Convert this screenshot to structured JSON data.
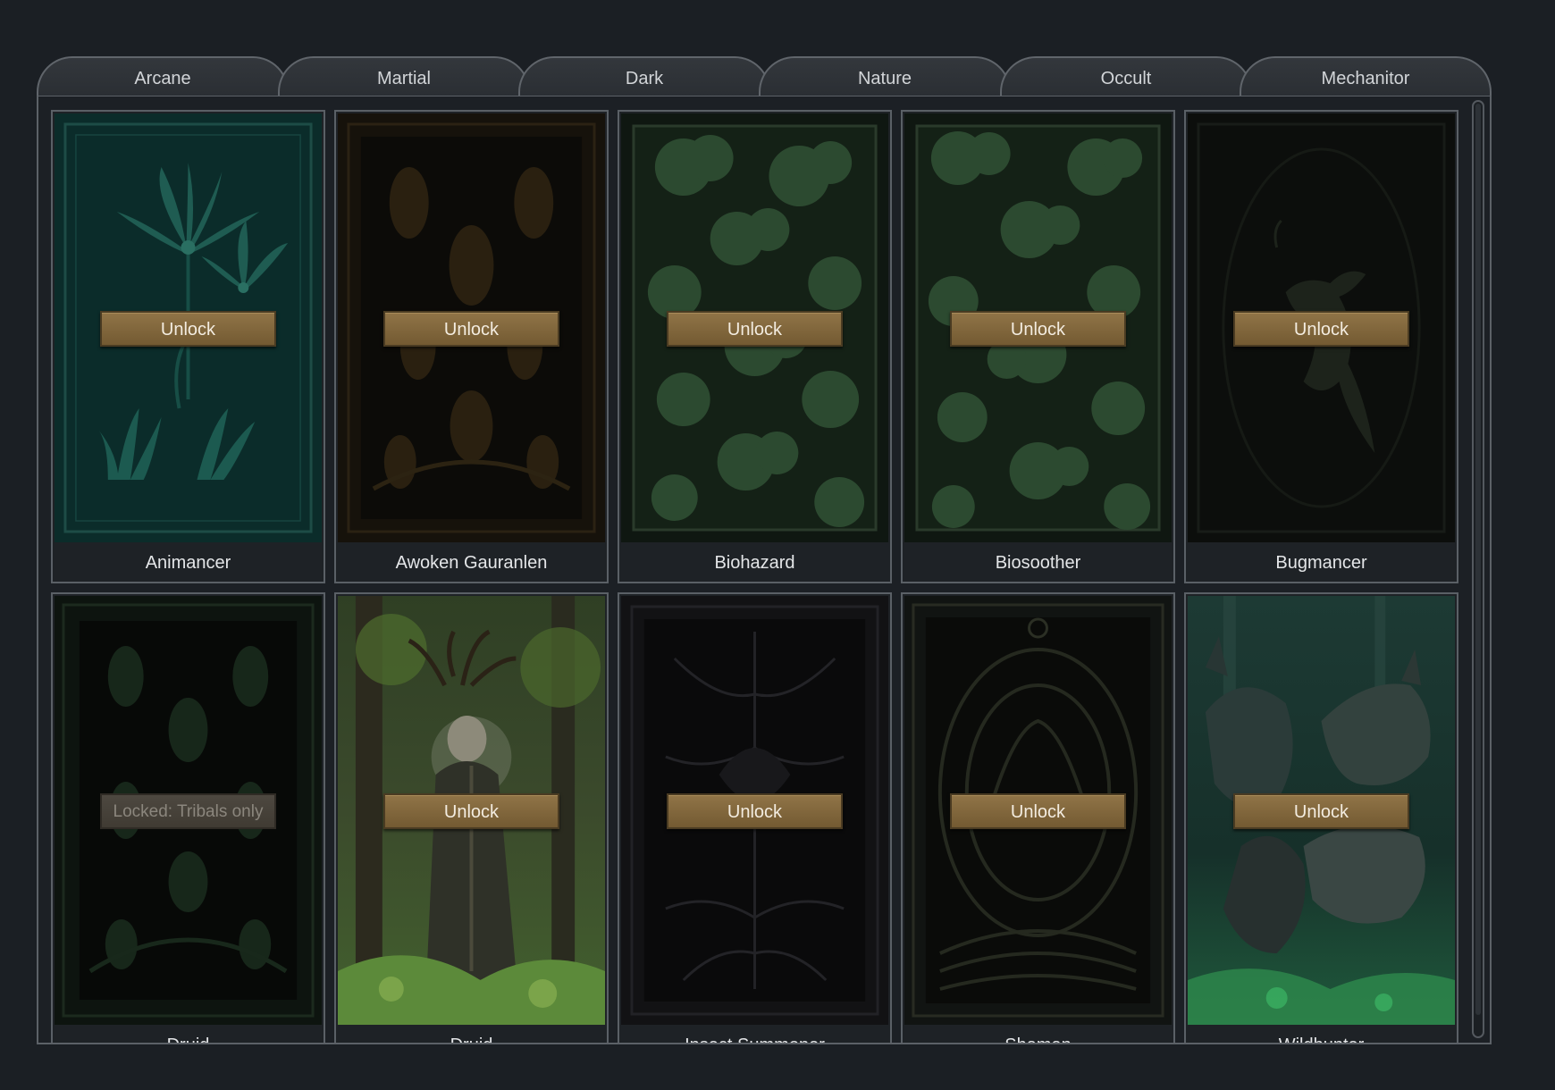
{
  "tabs": [
    "Arcane",
    "Martial",
    "Dark",
    "Nature",
    "Occult",
    "Mechanitor"
  ],
  "cards": [
    {
      "name": "Animancer",
      "button": "Unlock"
    },
    {
      "name": "Awoken Gauranlen",
      "button": "Unlock"
    },
    {
      "name": "Biohazard",
      "button": "Unlock"
    },
    {
      "name": "Biosoother",
      "button": "Unlock"
    },
    {
      "name": "Bugmancer",
      "button": "Unlock"
    },
    {
      "name": "Druid",
      "button": "Locked: Tribals only"
    },
    {
      "name": "Druid",
      "button": "Unlock"
    },
    {
      "name": "Insect Summoner",
      "button": "Unlock"
    },
    {
      "name": "Shaman",
      "button": "Unlock"
    },
    {
      "name": "Wildhunter",
      "button": "Unlock"
    }
  ],
  "colors": {
    "background": "#1b1f24",
    "button": "#86693f",
    "locked_button": "#48433b"
  }
}
